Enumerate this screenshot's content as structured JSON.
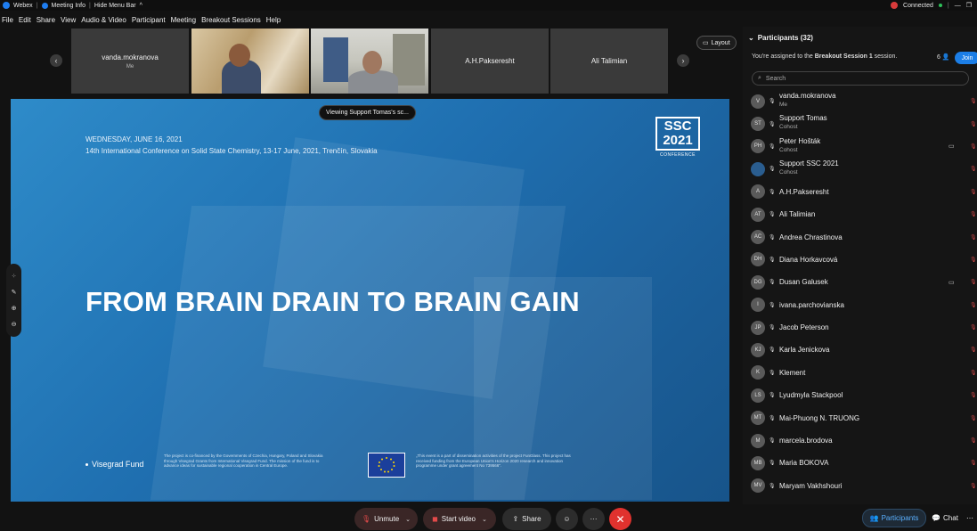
{
  "titlebar": {
    "app_name": "Webex",
    "meeting_info": "Meeting Info",
    "hide_menu": "Hide Menu Bar",
    "caret": "^",
    "connection": "Connected"
  },
  "menu": [
    "File",
    "Edit",
    "Share",
    "View",
    "Audio & Video",
    "Participant",
    "Meeting",
    "Breakout Sessions",
    "Help"
  ],
  "thumbnails": [
    {
      "name": "vanda.mokranova",
      "sub": "Me",
      "kind": "avatar"
    },
    {
      "name": "",
      "sub": "",
      "kind": "video1"
    },
    {
      "name": "",
      "sub": "",
      "kind": "video2"
    },
    {
      "name": "A.H.Pakseresht",
      "sub": "",
      "kind": "avatar"
    },
    {
      "name": "Ali Talimian",
      "sub": "",
      "kind": "avatar"
    }
  ],
  "layout_button": "Layout",
  "viewing_banner": "Viewing Support Tomas's sc...",
  "slide": {
    "date": "WEDNESDAY, JUNE 16, 2021",
    "conference": "14th International Conference on Solid State Chemistry, 13-17 June, 2021, Trenčín, Slovakia",
    "logo_line1": "SSC",
    "logo_line2": "2021",
    "logo_caption": "CONFERENCE",
    "title": "FROM BRAIN DRAIN TO BRAIN GAIN",
    "visegrad": "Visegrad Fund",
    "fine_left": "The project is co-financed by the Governments of Czechia, Hungary, Poland and Slovakia through Visegrad Grants from International Visegrad Fund. The mission of the fund is to advance ideas for sustainable regional cooperation in Central Europe.",
    "fine_right": "„This event is a part of dissemination activities of the project FunGlass. This project has received funding from the European Union's Horizon 2020 research and innovation programme under grant agreement No 739566\"."
  },
  "controls": {
    "unmute": "Unmute",
    "start_video": "Start video",
    "share": "Share",
    "more": "···",
    "end": "✕"
  },
  "panel": {
    "title": "Participants (32)",
    "assigned_prefix": "You're assigned to the ",
    "assigned_session": "Breakout Session 1",
    "assigned_suffix": " session.",
    "count": "6",
    "join": "Join",
    "search_placeholder": "Search",
    "participants_tab": "Participants",
    "chat_tab": "Chat"
  },
  "participants": [
    {
      "initials": "V",
      "name": "vanda.mokranova",
      "role": "Me",
      "cam": false,
      "mic": false
    },
    {
      "initials": "ST",
      "name": "Support Tomas",
      "role": "Cohost",
      "cam": false,
      "mic": true
    },
    {
      "initials": "PH",
      "name": "Peter Hošták",
      "role": "Cohost",
      "cam": true,
      "mic": true
    },
    {
      "initials": "",
      "name": "Support SSC 2021",
      "role": "Cohost",
      "cam": false,
      "mic": true,
      "logo": true
    },
    {
      "initials": "A",
      "name": "A.H.Pakseresht",
      "role": "",
      "cam": false,
      "mic": true
    },
    {
      "initials": "AT",
      "name": "Ali Talimian",
      "role": "",
      "cam": false,
      "mic": true
    },
    {
      "initials": "AC",
      "name": "Andrea Chrastinova",
      "role": "",
      "cam": false,
      "mic": true
    },
    {
      "initials": "DH",
      "name": "Diana Horkavcová",
      "role": "",
      "cam": false,
      "mic": true
    },
    {
      "initials": "DG",
      "name": "Dusan Galusek",
      "role": "",
      "cam": true,
      "mic": true
    },
    {
      "initials": "I",
      "name": "ivana.parchovianska",
      "role": "",
      "cam": false,
      "mic": true
    },
    {
      "initials": "JP",
      "name": "Jacob Peterson",
      "role": "",
      "cam": false,
      "mic": true
    },
    {
      "initials": "KJ",
      "name": "Karla Jenickova",
      "role": "",
      "cam": false,
      "mic": true
    },
    {
      "initials": "K",
      "name": "Klement",
      "role": "",
      "cam": false,
      "mic": true
    },
    {
      "initials": "LS",
      "name": "Lyudmyla Stackpool",
      "role": "",
      "cam": false,
      "mic": true
    },
    {
      "initials": "MT",
      "name": "Mai-Phuong N. TRUONG",
      "role": "",
      "cam": false,
      "mic": true
    },
    {
      "initials": "M",
      "name": "marcela.brodova",
      "role": "",
      "cam": false,
      "mic": true
    },
    {
      "initials": "MB",
      "name": "Maria BOKOVA",
      "role": "",
      "cam": false,
      "mic": true
    },
    {
      "initials": "MV",
      "name": "Maryam Vakhshouri",
      "role": "",
      "cam": false,
      "mic": true
    }
  ]
}
